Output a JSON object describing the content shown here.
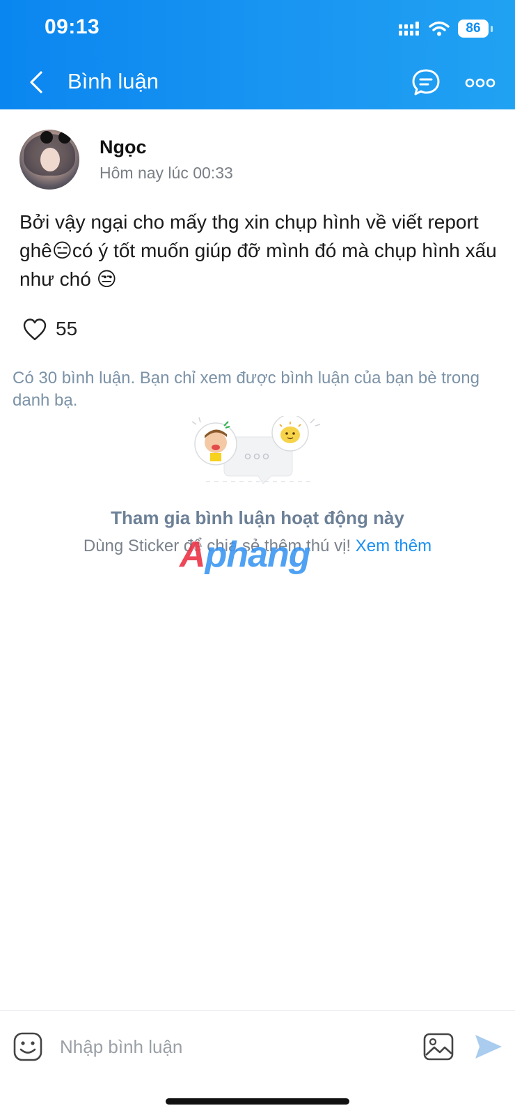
{
  "status_bar": {
    "time": "09:13",
    "battery": "86",
    "icons": [
      "cellular-signal-icon",
      "wifi-icon",
      "battery-icon"
    ]
  },
  "header": {
    "title": "Bình luận",
    "icons": [
      "back-arrow-icon",
      "chat-bubble-icon",
      "more-dots-icon"
    ],
    "colors": {
      "gradient_start": "#0a86f0",
      "gradient_end": "#20a2f2"
    }
  },
  "post": {
    "author": "Ngọc",
    "timestamp": "Hôm nay lúc 00:33",
    "text": "Bởi vậy ngại cho mấy thg xin chụp hình về viết report ghê😑có ý tốt muốn giúp đỡ mình đó mà chụp hình xấu như chó 😒",
    "likes": "55"
  },
  "comments": {
    "info": "Có 30 bình luận. Bạn chỉ xem được bình luận của bạn bè trong danh bạ.",
    "empty_title": "Tham gia bình luận hoạt động này",
    "empty_sub": "Dùng Sticker để chia sẻ thêm thú vị!",
    "empty_link": "Xem thêm"
  },
  "watermark": {
    "prefix": "A",
    "rest": "phang"
  },
  "composer": {
    "placeholder": "Nhập bình luận",
    "icons": [
      "emoji-icon",
      "image-icon",
      "send-icon"
    ]
  }
}
